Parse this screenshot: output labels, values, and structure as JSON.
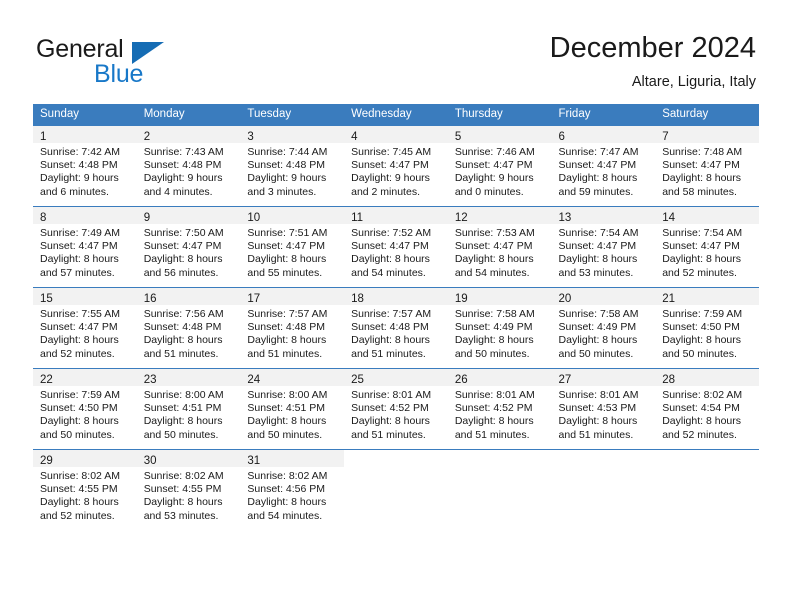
{
  "brand": {
    "name_part1": "General",
    "name_part2": "Blue",
    "triangle_color": "#156cb4",
    "blue_color": "#1878c8"
  },
  "header": {
    "title": "December 2024",
    "subtitle": "Altare, Liguria, Italy"
  },
  "theme": {
    "header_bar_color": "#3a7cbe",
    "daynum_band_color": "#f2f2f2",
    "text_color": "#1a1a1a"
  },
  "weekday_headers": [
    "Sunday",
    "Monday",
    "Tuesday",
    "Wednesday",
    "Thursday",
    "Friday",
    "Saturday"
  ],
  "weeks": [
    [
      {
        "day": "1",
        "sunrise": "Sunrise: 7:42 AM",
        "sunset": "Sunset: 4:48 PM",
        "daylight_line1": "Daylight: 9 hours",
        "daylight_line2": "and 6 minutes."
      },
      {
        "day": "2",
        "sunrise": "Sunrise: 7:43 AM",
        "sunset": "Sunset: 4:48 PM",
        "daylight_line1": "Daylight: 9 hours",
        "daylight_line2": "and 4 minutes."
      },
      {
        "day": "3",
        "sunrise": "Sunrise: 7:44 AM",
        "sunset": "Sunset: 4:48 PM",
        "daylight_line1": "Daylight: 9 hours",
        "daylight_line2": "and 3 minutes."
      },
      {
        "day": "4",
        "sunrise": "Sunrise: 7:45 AM",
        "sunset": "Sunset: 4:47 PM",
        "daylight_line1": "Daylight: 9 hours",
        "daylight_line2": "and 2 minutes."
      },
      {
        "day": "5",
        "sunrise": "Sunrise: 7:46 AM",
        "sunset": "Sunset: 4:47 PM",
        "daylight_line1": "Daylight: 9 hours",
        "daylight_line2": "and 0 minutes."
      },
      {
        "day": "6",
        "sunrise": "Sunrise: 7:47 AM",
        "sunset": "Sunset: 4:47 PM",
        "daylight_line1": "Daylight: 8 hours",
        "daylight_line2": "and 59 minutes."
      },
      {
        "day": "7",
        "sunrise": "Sunrise: 7:48 AM",
        "sunset": "Sunset: 4:47 PM",
        "daylight_line1": "Daylight: 8 hours",
        "daylight_line2": "and 58 minutes."
      }
    ],
    [
      {
        "day": "8",
        "sunrise": "Sunrise: 7:49 AM",
        "sunset": "Sunset: 4:47 PM",
        "daylight_line1": "Daylight: 8 hours",
        "daylight_line2": "and 57 minutes."
      },
      {
        "day": "9",
        "sunrise": "Sunrise: 7:50 AM",
        "sunset": "Sunset: 4:47 PM",
        "daylight_line1": "Daylight: 8 hours",
        "daylight_line2": "and 56 minutes."
      },
      {
        "day": "10",
        "sunrise": "Sunrise: 7:51 AM",
        "sunset": "Sunset: 4:47 PM",
        "daylight_line1": "Daylight: 8 hours",
        "daylight_line2": "and 55 minutes."
      },
      {
        "day": "11",
        "sunrise": "Sunrise: 7:52 AM",
        "sunset": "Sunset: 4:47 PM",
        "daylight_line1": "Daylight: 8 hours",
        "daylight_line2": "and 54 minutes."
      },
      {
        "day": "12",
        "sunrise": "Sunrise: 7:53 AM",
        "sunset": "Sunset: 4:47 PM",
        "daylight_line1": "Daylight: 8 hours",
        "daylight_line2": "and 54 minutes."
      },
      {
        "day": "13",
        "sunrise": "Sunrise: 7:54 AM",
        "sunset": "Sunset: 4:47 PM",
        "daylight_line1": "Daylight: 8 hours",
        "daylight_line2": "and 53 minutes."
      },
      {
        "day": "14",
        "sunrise": "Sunrise: 7:54 AM",
        "sunset": "Sunset: 4:47 PM",
        "daylight_line1": "Daylight: 8 hours",
        "daylight_line2": "and 52 minutes."
      }
    ],
    [
      {
        "day": "15",
        "sunrise": "Sunrise: 7:55 AM",
        "sunset": "Sunset: 4:47 PM",
        "daylight_line1": "Daylight: 8 hours",
        "daylight_line2": "and 52 minutes."
      },
      {
        "day": "16",
        "sunrise": "Sunrise: 7:56 AM",
        "sunset": "Sunset: 4:48 PM",
        "daylight_line1": "Daylight: 8 hours",
        "daylight_line2": "and 51 minutes."
      },
      {
        "day": "17",
        "sunrise": "Sunrise: 7:57 AM",
        "sunset": "Sunset: 4:48 PM",
        "daylight_line1": "Daylight: 8 hours",
        "daylight_line2": "and 51 minutes."
      },
      {
        "day": "18",
        "sunrise": "Sunrise: 7:57 AM",
        "sunset": "Sunset: 4:48 PM",
        "daylight_line1": "Daylight: 8 hours",
        "daylight_line2": "and 51 minutes."
      },
      {
        "day": "19",
        "sunrise": "Sunrise: 7:58 AM",
        "sunset": "Sunset: 4:49 PM",
        "daylight_line1": "Daylight: 8 hours",
        "daylight_line2": "and 50 minutes."
      },
      {
        "day": "20",
        "sunrise": "Sunrise: 7:58 AM",
        "sunset": "Sunset: 4:49 PM",
        "daylight_line1": "Daylight: 8 hours",
        "daylight_line2": "and 50 minutes."
      },
      {
        "day": "21",
        "sunrise": "Sunrise: 7:59 AM",
        "sunset": "Sunset: 4:50 PM",
        "daylight_line1": "Daylight: 8 hours",
        "daylight_line2": "and 50 minutes."
      }
    ],
    [
      {
        "day": "22",
        "sunrise": "Sunrise: 7:59 AM",
        "sunset": "Sunset: 4:50 PM",
        "daylight_line1": "Daylight: 8 hours",
        "daylight_line2": "and 50 minutes."
      },
      {
        "day": "23",
        "sunrise": "Sunrise: 8:00 AM",
        "sunset": "Sunset: 4:51 PM",
        "daylight_line1": "Daylight: 8 hours",
        "daylight_line2": "and 50 minutes."
      },
      {
        "day": "24",
        "sunrise": "Sunrise: 8:00 AM",
        "sunset": "Sunset: 4:51 PM",
        "daylight_line1": "Daylight: 8 hours",
        "daylight_line2": "and 50 minutes."
      },
      {
        "day": "25",
        "sunrise": "Sunrise: 8:01 AM",
        "sunset": "Sunset: 4:52 PM",
        "daylight_line1": "Daylight: 8 hours",
        "daylight_line2": "and 51 minutes."
      },
      {
        "day": "26",
        "sunrise": "Sunrise: 8:01 AM",
        "sunset": "Sunset: 4:52 PM",
        "daylight_line1": "Daylight: 8 hours",
        "daylight_line2": "and 51 minutes."
      },
      {
        "day": "27",
        "sunrise": "Sunrise: 8:01 AM",
        "sunset": "Sunset: 4:53 PM",
        "daylight_line1": "Daylight: 8 hours",
        "daylight_line2": "and 51 minutes."
      },
      {
        "day": "28",
        "sunrise": "Sunrise: 8:02 AM",
        "sunset": "Sunset: 4:54 PM",
        "daylight_line1": "Daylight: 8 hours",
        "daylight_line2": "and 52 minutes."
      }
    ],
    [
      {
        "day": "29",
        "sunrise": "Sunrise: 8:02 AM",
        "sunset": "Sunset: 4:55 PM",
        "daylight_line1": "Daylight: 8 hours",
        "daylight_line2": "and 52 minutes."
      },
      {
        "day": "30",
        "sunrise": "Sunrise: 8:02 AM",
        "sunset": "Sunset: 4:55 PM",
        "daylight_line1": "Daylight: 8 hours",
        "daylight_line2": "and 53 minutes."
      },
      {
        "day": "31",
        "sunrise": "Sunrise: 8:02 AM",
        "sunset": "Sunset: 4:56 PM",
        "daylight_line1": "Daylight: 8 hours",
        "daylight_line2": "and 54 minutes."
      },
      null,
      null,
      null,
      null
    ]
  ]
}
